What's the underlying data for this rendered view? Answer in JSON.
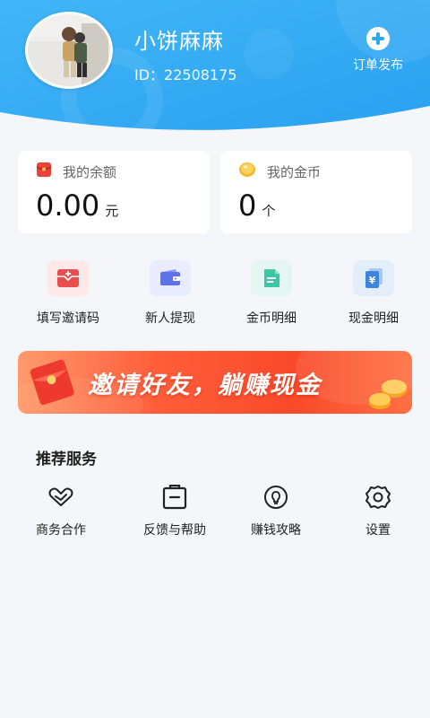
{
  "profile": {
    "nickname": "小饼麻麻",
    "id_text": "ID：22508175",
    "publish_label": "订单发布"
  },
  "balance": {
    "label": "我的余额",
    "amount": "0.00",
    "unit": "元"
  },
  "coins": {
    "label": "我的金币",
    "amount": "0",
    "unit": "个"
  },
  "quick_actions": [
    {
      "label": "填写邀请码",
      "icon": "invite-code-icon"
    },
    {
      "label": "新人提现",
      "icon": "wallet-icon"
    },
    {
      "label": "金币明细",
      "icon": "document-icon"
    },
    {
      "label": "现金明细",
      "icon": "yen-card-icon"
    }
  ],
  "banner": {
    "text": "邀请好友，躺赚现金"
  },
  "services": {
    "title": "推荐服务",
    "items": [
      {
        "label": "商务合作",
        "icon": "handshake-icon"
      },
      {
        "label": "反馈与帮助",
        "icon": "clipboard-icon"
      },
      {
        "label": "赚钱攻略",
        "icon": "lightbulb-icon"
      },
      {
        "label": "设置",
        "icon": "gear-icon"
      }
    ]
  },
  "colors": {
    "header_blue": "#36aef5",
    "accent_red": "#f94a2a"
  }
}
